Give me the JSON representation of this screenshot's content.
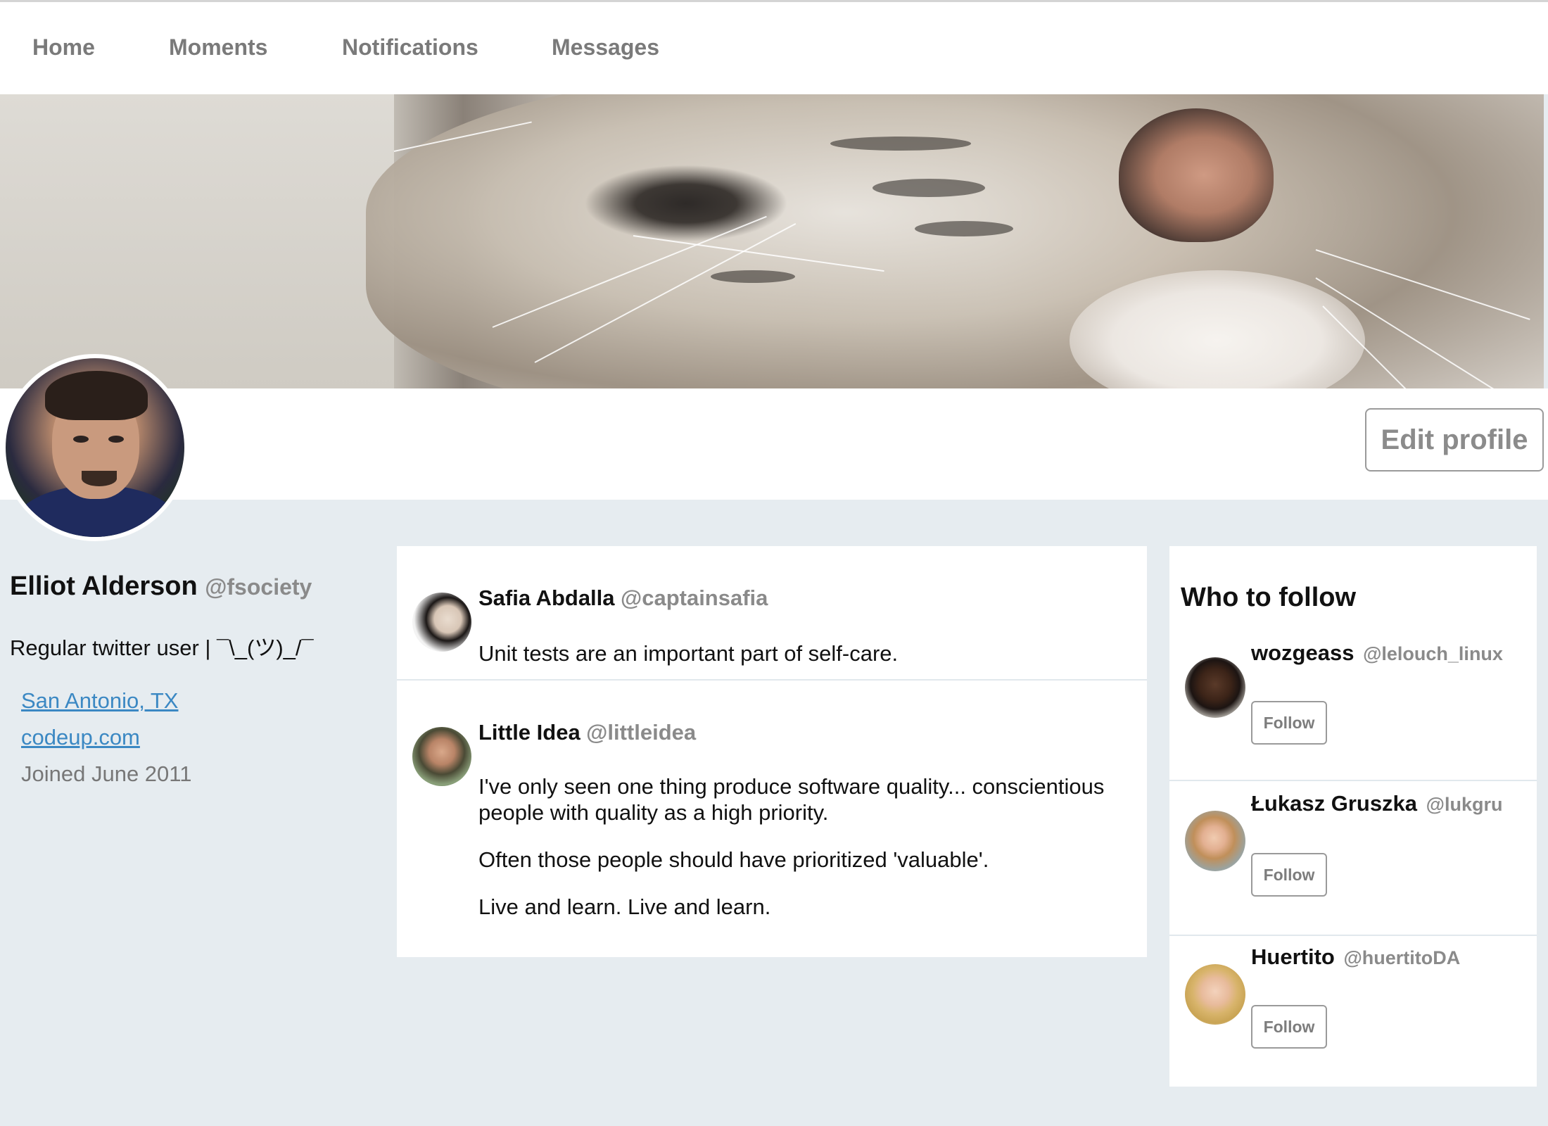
{
  "nav": {
    "items": [
      {
        "label": "Home"
      },
      {
        "label": "Moments"
      },
      {
        "label": "Notifications"
      },
      {
        "label": "Messages"
      }
    ]
  },
  "profile": {
    "name": "Elliot Alderson",
    "handle": "@fsociety",
    "bio": "Regular twitter user | ¯\\_(ツ)_/¯",
    "location": "San Antonio, TX",
    "website": "codeup.com",
    "joined": "Joined June 2011",
    "edit_label": "Edit profile"
  },
  "tweets": [
    {
      "name": "Safia Abdalla",
      "handle": "@captainsafia",
      "paragraphs": [
        "Unit tests are an important part of self-care."
      ]
    },
    {
      "name": "Little Idea",
      "handle": "@littleidea",
      "paragraphs": [
        "I've only seen one thing produce software quality... conscientious people with quality as a high priority.",
        "Often those people should have prioritized 'valuable'.",
        "Live and learn. Live and learn."
      ]
    }
  ],
  "who_to_follow": {
    "title": "Who to follow",
    "follow_label": "Follow",
    "users": [
      {
        "name": "wozgeass",
        "handle": "@lelouch_linux"
      },
      {
        "name": "Łukasz Gruszka",
        "handle": "@lukgru"
      },
      {
        "name": "Huertito",
        "handle": "@huertitoDA"
      }
    ]
  },
  "colors": {
    "link": "#3b88c3",
    "muted": "#8a8a8a",
    "page_bg": "#e6ecf0"
  }
}
